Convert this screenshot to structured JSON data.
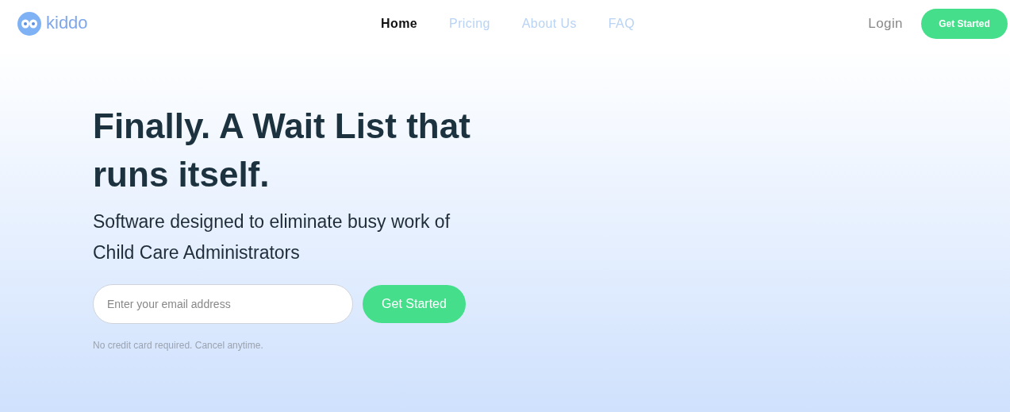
{
  "logo": {
    "text": "kiddo"
  },
  "nav": [
    {
      "label": "Home",
      "selected": true
    },
    {
      "label": "Pricing",
      "selected": false
    },
    {
      "label": "About Us",
      "selected": false
    },
    {
      "label": "FAQ",
      "selected": false
    }
  ],
  "login": "Login",
  "header_button": "Get Started",
  "hero": {
    "title": "Finally. A Wait List that runs itself.",
    "subtitle": "Software designed to eliminate busy work of Child Care Administrators",
    "email": {
      "placeholder": "Enter your email address"
    },
    "button": "Get Started",
    "note": "No credit card required. Cancel anytime."
  }
}
